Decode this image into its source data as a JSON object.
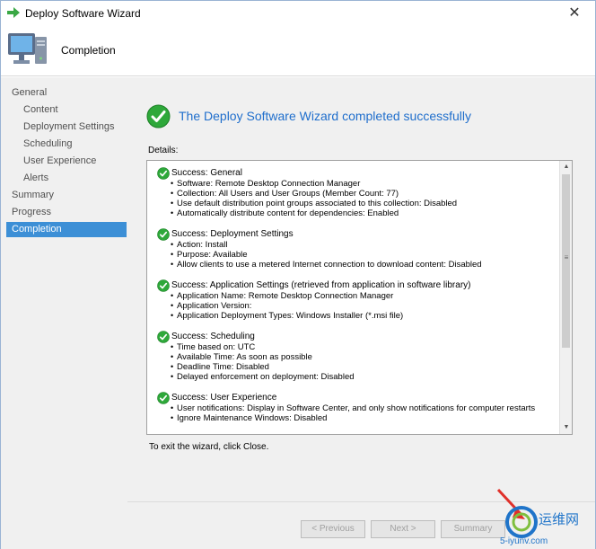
{
  "window": {
    "title": "Deploy Software Wizard",
    "close_glyph": "✕"
  },
  "header": {
    "page_title": "Completion",
    "icon": "computer-icon"
  },
  "sidebar": {
    "items": [
      {
        "label": "General"
      },
      {
        "label": "Content"
      },
      {
        "label": "Deployment Settings"
      },
      {
        "label": "Scheduling"
      },
      {
        "label": "User Experience"
      },
      {
        "label": "Alerts"
      },
      {
        "label": "Summary"
      },
      {
        "label": "Progress"
      },
      {
        "label": "Completion"
      }
    ],
    "active_color": "#3c8fd6"
  },
  "main": {
    "success_heading": "The Deploy Software Wizard completed successfully",
    "details_label": "Details:",
    "exit_hint": "To exit the wizard, click Close.",
    "sections": [
      {
        "title": "Success: General",
        "lines": [
          "Software: Remote Desktop Connection Manager",
          "Collection: All Users and User Groups (Member Count: 77)",
          "Use default distribution point groups associated to this collection: Disabled",
          "Automatically distribute content for dependencies: Enabled"
        ]
      },
      {
        "title": "Success: Deployment Settings",
        "lines": [
          "Action: Install",
          "Purpose: Available",
          "Allow clients to use a metered Internet connection to download content: Disabled"
        ]
      },
      {
        "title": "Success: Application Settings (retrieved from application in software library)",
        "lines": [
          "Application Name: Remote Desktop Connection Manager",
          "Application Version:",
          "Application Deployment Types: Windows Installer (*.msi file)"
        ]
      },
      {
        "title": "Success: Scheduling",
        "lines": [
          "Time based on: UTC",
          "Available Time: As soon as possible",
          "Deadline Time: Disabled",
          "Delayed enforcement on deployment: Disabled"
        ]
      },
      {
        "title": "Success: User Experience",
        "lines": [
          "User notifications: Display in Software Center, and only show notifications for computer restarts",
          "Ignore Maintenance Windows: Disabled"
        ]
      }
    ]
  },
  "footer": {
    "previous": "< Previous",
    "next": "Next >",
    "summary": "Summary"
  },
  "watermark": {
    "text": "运维网",
    "subtext": "5-iyunv.com"
  },
  "colors": {
    "heading_blue": "#1f6ecc",
    "success_green": "#2ea83a"
  }
}
